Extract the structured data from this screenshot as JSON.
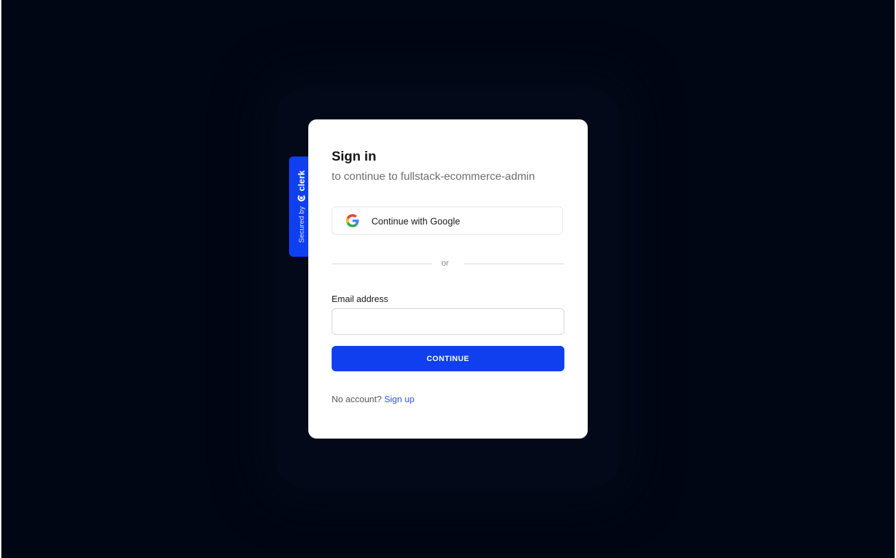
{
  "signin": {
    "title": "Sign in",
    "subtitle": "to continue to fullstack-ecommerce-admin",
    "google_button_label": "Continue with Google",
    "divider_text": "or",
    "email_label": "Email address",
    "email_value": "",
    "email_placeholder": "",
    "continue_label": "CONTINUE",
    "footer_text": "No account?",
    "signup_label": "Sign up"
  },
  "badge": {
    "secured_text": "Secured by",
    "brand_text": "clerk"
  },
  "icons": {
    "google": "google-icon",
    "clerk": "clerk-logo-icon"
  },
  "colors": {
    "background": "#010614",
    "card": "#ffffff",
    "accent": "#103ff0",
    "link": "#2b56e6"
  }
}
